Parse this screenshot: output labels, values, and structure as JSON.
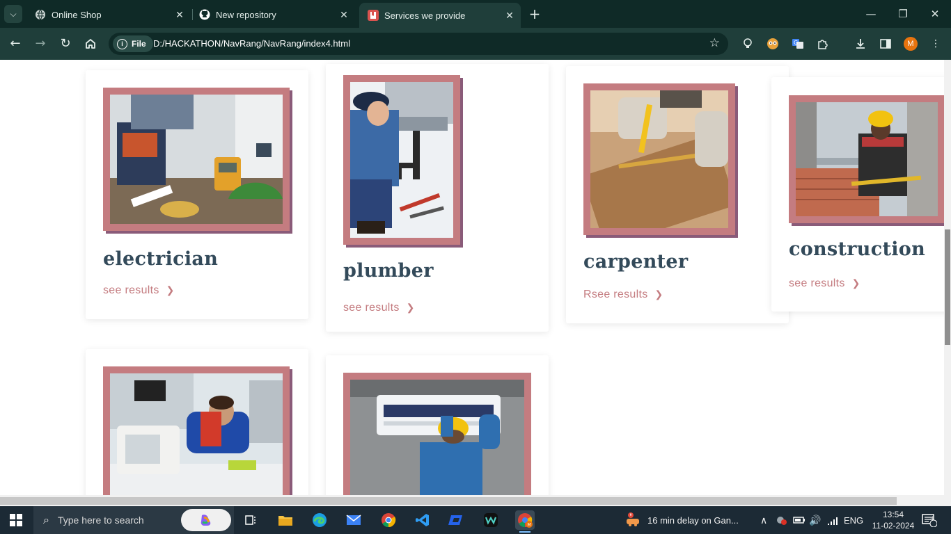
{
  "browser": {
    "tabs": [
      {
        "title": "Online Shop",
        "icon": "globe-icon",
        "active": false
      },
      {
        "title": "New repository",
        "icon": "github-icon",
        "active": false
      },
      {
        "title": "Services we provide",
        "icon": "page-icon",
        "active": true
      }
    ],
    "address": {
      "chip_label": "File",
      "url": "D:/HACKATHON/NavRang/NavRang/index4.html"
    },
    "profile_initial": "M"
  },
  "services": [
    {
      "title": "electrician",
      "link": "see results"
    },
    {
      "title": "plumber",
      "link": "see results"
    },
    {
      "title": "carpenter",
      "link": "Rsee results"
    },
    {
      "title": "construction",
      "link": "see results"
    },
    {
      "title": "",
      "link": ""
    },
    {
      "title": "",
      "link": ""
    }
  ],
  "taskbar": {
    "search_placeholder": "Type here to search",
    "weather_text": "16 min delay on Gan...",
    "language": "ENG",
    "time": "13:54",
    "date": "11-02-2024",
    "notification_count": "4"
  },
  "colors": {
    "accent": "#c47c80",
    "frame_shadow": "#8a5b79",
    "heading": "#334a5a",
    "chrome_dark": "#0f2a27",
    "chrome_toolbar": "#1f3e3a"
  }
}
